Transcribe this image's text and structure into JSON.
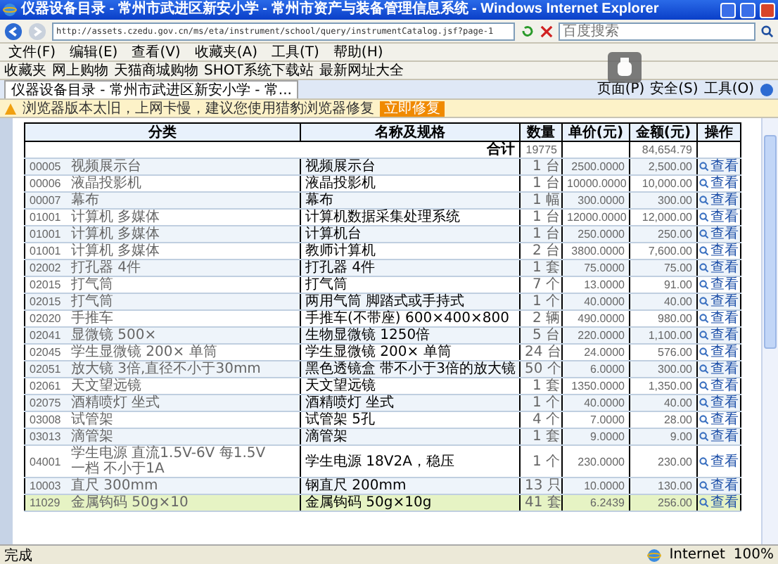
{
  "window": {
    "title": "仪器设备目录 - 常州市武进区新安小学 - 常州市资产与装备管理信息系统 - Windows Internet Explorer"
  },
  "address": "http://assets.czedu.gov.cn/ms/eta/instrument/school/query/instrumentCatalog.jsf?page-1",
  "search": {
    "placeholder": "百度搜索"
  },
  "menu": [
    "文件(F)",
    "编辑(E)",
    "查看(V)",
    "收藏夹(A)",
    "工具(T)",
    "帮助(H)"
  ],
  "favorites": [
    "收藏夹",
    "网上购物",
    "天猫商城购物",
    "SHOT系统下载站",
    "最新网址大全"
  ],
  "tab": {
    "label": "仪器设备目录 - 常州市武进区新安小学 - 常..."
  },
  "commands": [
    "页面(P)",
    "安全(S)",
    "工具(O)"
  ],
  "infobar": {
    "message": "浏览器版本太旧，上网卡慢，建议您使用猎豹浏览器修复",
    "button": "立即修复"
  },
  "table": {
    "columns": [
      "分类",
      "名称及规格",
      "数量",
      "单价(元)",
      "金额(元)",
      "操作"
    ],
    "total": {
      "label": "合计",
      "qty": "19775",
      "amount": "84,654.79"
    },
    "rows": [
      {
        "code": "00005",
        "category": "视频展示台",
        "name": "视频展示台",
        "qty": "1 台",
        "price": "2500.0000",
        "amount": "2,500.00",
        "action": "查看",
        "selected": false
      },
      {
        "code": "00006",
        "category": "液晶投影机",
        "name": "液晶投影机",
        "qty": "1 台",
        "price": "10000.0000",
        "amount": "10,000.00",
        "action": "查看",
        "selected": false
      },
      {
        "code": "00007",
        "category": "幕布",
        "name": "幕布",
        "qty": "1 幅",
        "price": "300.0000",
        "amount": "300.00",
        "action": "查看",
        "selected": false
      },
      {
        "code": "01001",
        "category": "计算机 多媒体",
        "name": "计算机数据采集处理系统",
        "qty": "1 台",
        "price": "12000.0000",
        "amount": "12,000.00",
        "action": "查看",
        "selected": false
      },
      {
        "code": "01001",
        "category": "计算机 多媒体",
        "name": "计算机台",
        "qty": "1 台",
        "price": "250.0000",
        "amount": "250.00",
        "action": "查看",
        "selected": false
      },
      {
        "code": "01001",
        "category": "计算机 多媒体",
        "name": "教师计算机",
        "qty": "2 台",
        "price": "3800.0000",
        "amount": "7,600.00",
        "action": "查看",
        "selected": false
      },
      {
        "code": "02002",
        "category": "打孔器 4件",
        "name": "打孔器 4件",
        "qty": "1 套",
        "price": "75.0000",
        "amount": "75.00",
        "action": "查看",
        "selected": false
      },
      {
        "code": "02015",
        "category": "打气筒",
        "name": "打气筒",
        "qty": "7 个",
        "price": "13.0000",
        "amount": "91.00",
        "action": "查看",
        "selected": false
      },
      {
        "code": "02015",
        "category": "打气筒",
        "name": "两用气筒 脚踏式或手持式",
        "qty": "1 个",
        "price": "40.0000",
        "amount": "40.00",
        "action": "查看",
        "selected": false
      },
      {
        "code": "02020",
        "category": "手推车",
        "name": "手推车(不带座) 600×400×800",
        "qty": "2 辆",
        "price": "490.0000",
        "amount": "980.00",
        "action": "查看",
        "selected": false
      },
      {
        "code": "02041",
        "category": "显微镜 500×",
        "name": "生物显微镜 1250倍",
        "qty": "5 台",
        "price": "220.0000",
        "amount": "1,100.00",
        "action": "查看",
        "selected": false
      },
      {
        "code": "02045",
        "category": "学生显微镜 200× 单筒",
        "name": "学生显微镜 200× 单筒",
        "qty": "24 台",
        "price": "24.0000",
        "amount": "576.00",
        "action": "查看",
        "selected": false
      },
      {
        "code": "02051",
        "category": "放大镜 3倍,直径不小于30mm",
        "name": "黑色透镜盒 带不小于3倍的放大镜",
        "qty": "50 个",
        "price": "6.0000",
        "amount": "300.00",
        "action": "查看",
        "selected": false
      },
      {
        "code": "02061",
        "category": "天文望远镜",
        "name": "天文望远镜",
        "qty": "1 套",
        "price": "1350.0000",
        "amount": "1,350.00",
        "action": "查看",
        "selected": false
      },
      {
        "code": "02075",
        "category": "酒精喷灯 坐式",
        "name": "酒精喷灯 坐式",
        "qty": "1 个",
        "price": "40.0000",
        "amount": "40.00",
        "action": "查看",
        "selected": false
      },
      {
        "code": "03008",
        "category": "试管架",
        "name": "试管架 5孔",
        "qty": "4 个",
        "price": "7.0000",
        "amount": "28.00",
        "action": "查看",
        "selected": false
      },
      {
        "code": "03013",
        "category": "滴管架",
        "name": "滴管架",
        "qty": "1 套",
        "price": "9.0000",
        "amount": "9.00",
        "action": "查看",
        "selected": false
      },
      {
        "code": "04001",
        "category": "学生电源 直流1.5V-6V 每1.5V一档 不小于1A",
        "name": "学生电源 18V2A，稳压",
        "qty": "1 个",
        "price": "230.0000",
        "amount": "230.00",
        "action": "查看",
        "selected": false
      },
      {
        "code": "10003",
        "category": "直尺 300mm",
        "name": "钢直尺 200mm",
        "qty": "13 只",
        "price": "10.0000",
        "amount": "130.00",
        "action": "查看",
        "selected": false
      },
      {
        "code": "11029",
        "category": "金属钩码 50g×10",
        "name": "金属钩码 50g×10g",
        "qty": "41 套",
        "price": "6.2439",
        "amount": "256.00",
        "action": "查看",
        "selected": true
      }
    ]
  },
  "status": {
    "text": "完成",
    "zone": "Internet",
    "zoom": "100%"
  }
}
